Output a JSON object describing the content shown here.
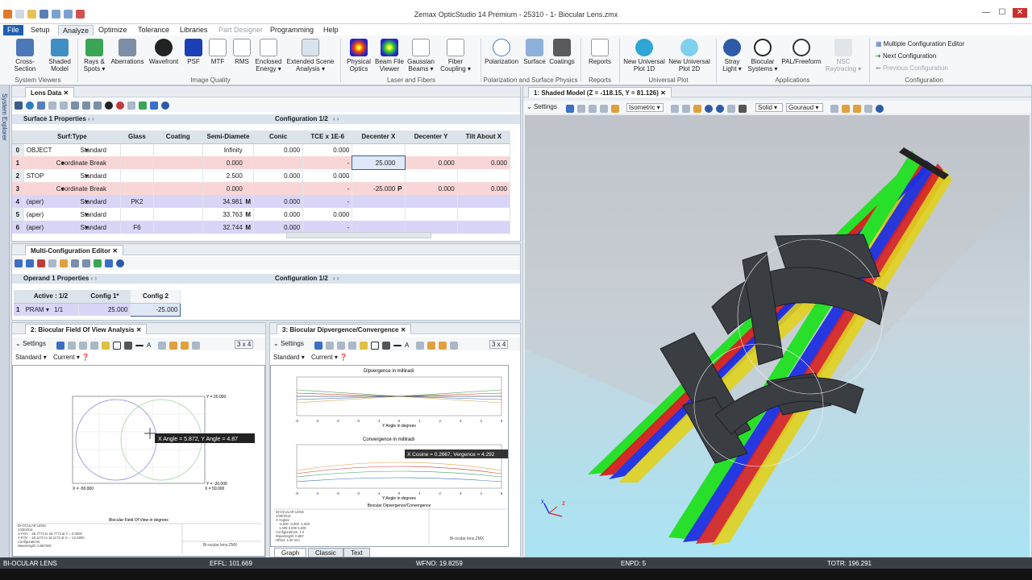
{
  "app": {
    "title": "Zemax OpticStudio 14 Premium - 25310 - 1- Biocular Lens.zmx"
  },
  "menu": {
    "items": [
      "File",
      "Setup",
      "Analyze",
      "Optimize",
      "Tolerance",
      "Libraries",
      "Part Designer",
      "Programming",
      "Help"
    ]
  },
  "ribbon": {
    "buttons": [
      {
        "l1": "Cross-Section",
        "l2": ""
      },
      {
        "l1": "Shaded",
        "l2": "Model"
      },
      {
        "l1": "Rays &",
        "l2": "Spots ▾"
      },
      {
        "l1": "Aberrations",
        "l2": ""
      },
      {
        "l1": "Wavefront",
        "l2": ""
      },
      {
        "l1": "PSF",
        "l2": ""
      },
      {
        "l1": "MTF",
        "l2": ""
      },
      {
        "l1": "RMS",
        "l2": ""
      },
      {
        "l1": "Enclosed",
        "l2": "Energy ▾"
      },
      {
        "l1": "Extended Scene",
        "l2": "Analysis ▾"
      },
      {
        "l1": "Physical",
        "l2": "Optics"
      },
      {
        "l1": "Beam File",
        "l2": "Viewer"
      },
      {
        "l1": "Gaussian",
        "l2": "Beams ▾"
      },
      {
        "l1": "Fiber",
        "l2": "Coupling ▾"
      },
      {
        "l1": "Polarization",
        "l2": ""
      },
      {
        "l1": "Surface",
        "l2": ""
      },
      {
        "l1": "Coatings",
        "l2": ""
      },
      {
        "l1": "Reports",
        "l2": ""
      },
      {
        "l1": "New Universal",
        "l2": "Plot 1D"
      },
      {
        "l1": "New Universal",
        "l2": "Plot 2D"
      },
      {
        "l1": "Stray",
        "l2": "Light ▾"
      },
      {
        "l1": "Biocular",
        "l2": "Systems ▾"
      },
      {
        "l1": "PAL/Freeform",
        "l2": ""
      },
      {
        "l1": "NSC",
        "l2": "Raytracing ▾"
      }
    ],
    "groups": [
      "System Viewers",
      "Image Quality",
      "Laser and Fibers",
      "Polarization and Surface Physics",
      "Reports",
      "Universal Plot",
      "Applications",
      "Configuration"
    ],
    "config": [
      "Multiple Configuration Editor",
      "Next Configuration",
      "Previous Configuration"
    ]
  },
  "sidebar": {
    "label": "System Explorer"
  },
  "lens": {
    "tab": "Lens Data",
    "props": "Surface 1 Properties",
    "config": "Configuration 1/2",
    "headers": [
      "Surf:Type",
      "Glass",
      "Coating",
      "Semi-Diamete",
      "Conic",
      "TCE x 1E-6",
      "Decenter X",
      "Decenter Y",
      "Tilt About X"
    ],
    "rows": [
      {
        "n": "0",
        "name": "OBJECT",
        "type": "Standard",
        "glass": "",
        "semi": "Infinity",
        "sf": "",
        "conic": "0.000",
        "tce": "0.000",
        "dx": "",
        "dy": "",
        "tx": ""
      },
      {
        "n": "1",
        "name": "",
        "type": "Coordinate Break",
        "glass": "",
        "semi": "0.000",
        "sf": "",
        "conic": "",
        "tce": "-",
        "dx": "25.000",
        "dy": "0.000",
        "tx": "0.000"
      },
      {
        "n": "2",
        "name": "STOP",
        "type": "Standard",
        "glass": "",
        "semi": "2.500",
        "sf": "",
        "conic": "0.000",
        "tce": "0.000",
        "dx": "",
        "dy": "",
        "tx": ""
      },
      {
        "n": "3",
        "name": "",
        "type": "Coordinate Break",
        "glass": "",
        "semi": "0.000",
        "sf": "",
        "conic": "",
        "tce": "-",
        "dx": "-25.000",
        "dxf": "P",
        "dy": "0.000",
        "tx": "0.000"
      },
      {
        "n": "4",
        "name": "(aper)",
        "type": "Standard",
        "glass": "PK2",
        "semi": "34.981",
        "sf": "M",
        "conic": "0.000",
        "tce": "-",
        "dx": "",
        "dy": "",
        "tx": ""
      },
      {
        "n": "5",
        "name": "(aper)",
        "type": "Standard",
        "glass": "",
        "semi": "33.763",
        "sf": "M",
        "conic": "0.000",
        "tce": "0.000",
        "dx": "",
        "dy": "",
        "tx": ""
      },
      {
        "n": "6",
        "name": "(aper)",
        "type": "Standard",
        "glass": "F6",
        "semi": "32.744",
        "sf": "M",
        "conic": "0.000",
        "tce": "-",
        "dx": "",
        "dy": "",
        "tx": ""
      }
    ]
  },
  "mce": {
    "tab": "Multi-Configuration Editor",
    "props": "Operand 1 Properties",
    "config": "Configuration 1/2",
    "headers": [
      "Active : 1/2",
      "Config 1*",
      "Config 2"
    ],
    "row": {
      "n": "1",
      "op": "PRAM",
      "arg": "1/1",
      "c1": "25.000",
      "c2": "-25.000"
    }
  },
  "fov": {
    "tab": "2: Biocular Field Of View Analysis",
    "settings": "Settings",
    "standard": "Standard ▾",
    "current": "Current ▾",
    "grid": "3 x 4",
    "tooltip": "X Angle = 5.872, Y Angle = 4.87",
    "ytop": "Y = 20.000",
    "ybot": "Y = -20.000",
    "xleft": "X = -50.000",
    "xright": "X = 50.000",
    "caption": "Biocular Field Of View in degrees",
    "info": [
      "BI-OCULAR LENS",
      "1/30/2014",
      "X-FOV : -26.7773 to 26.7773 at Y = 0.0000",
      "Y-FOV : -18.1172 to 18.1172 at X = -12.5000",
      "Configurations:",
      "Wavelength: 0.587000"
    ],
    "file": "Bi-ocular lens.ZMX"
  },
  "div": {
    "tab": "3: Biocular Dipvergence/Convergence",
    "settings": "Settings",
    "standard": "Standard ▾",
    "current": "Current ▾",
    "grid": "3 x 4",
    "t1": "Dipvergence in milliradi",
    "t2": "Convergence in milliradi",
    "xl": "Y Angle in degrees",
    "tooltip": "X Cosine = 0.2667, Vergence = 4.292",
    "caption": "Biocular Dipvergence/Convergence",
    "info": [
      "BI-OCULAR LENS",
      "1/30/2014",
      "X Angles:",
      "-5.000   -3.000   -1.000",
      "1.000    3.000    5.000",
      "Configurations: 1 2",
      "Wavelength: 0.587",
      "Offset: 4.00 mm"
    ],
    "file": "Bi-ocular lens.ZMX",
    "ticks": [
      "-5",
      "-4",
      "-3",
      "-2",
      "-1",
      "0",
      "1",
      "2",
      "3",
      "4",
      "5"
    ],
    "bottomtabs": [
      "Graph",
      "Classic",
      "Text"
    ]
  },
  "shaded": {
    "tab": "1: Shaded Model (Z = -118.15, Y = 81.126)",
    "settings": "Settings",
    "view": "Isometric",
    "solid": "Solid",
    "shade": "Gouraud"
  },
  "status": {
    "left": "BI-OCULAR LENS",
    "effl": "EFFL: 101.669",
    "wfno": "WFNO: 19.8259",
    "enpd": "ENPD: 5",
    "totr": "TOTR: 196.291"
  }
}
